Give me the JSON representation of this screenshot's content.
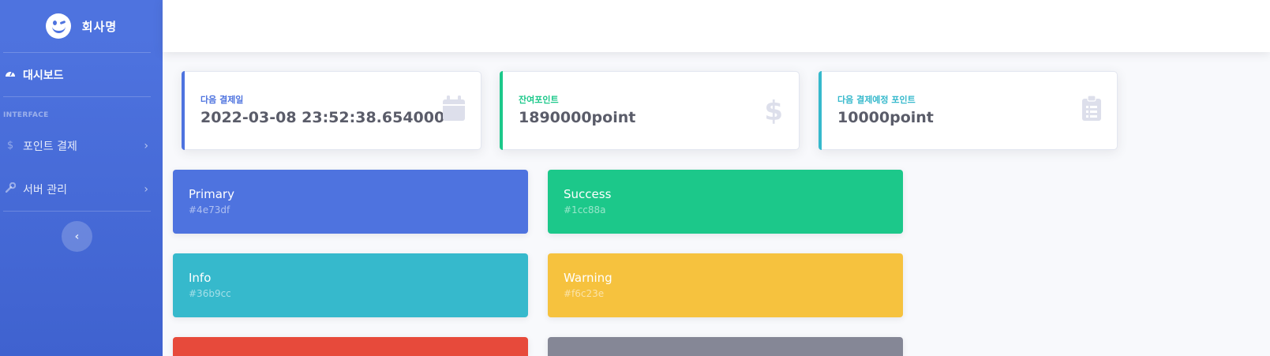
{
  "brand": {
    "name": "회사명",
    "logo_icon": "winking-face-icon"
  },
  "sidebar": {
    "dashboard": {
      "label": "대시보드",
      "icon": "tachometer-icon"
    },
    "heading": "INTERFACE",
    "items": [
      {
        "label": "포인트 결제",
        "icon": "dollar-icon"
      },
      {
        "label": "서버 관리",
        "icon": "wrench-icon"
      }
    ],
    "toggle_icon": "chevron-left-icon"
  },
  "stats": [
    {
      "label": "다음 결제일",
      "value": "2022-03-08 23:52:38.654000",
      "color": "#4e73df",
      "icon": "calendar-icon"
    },
    {
      "label": "잔여포인트",
      "value": "1890000point",
      "color": "#1cc88a",
      "icon": "dollar-icon"
    },
    {
      "label": "다음 결제예정 포인트",
      "value": "10000point",
      "color": "#36b9cc",
      "icon": "clipboard-list-icon"
    }
  ],
  "color_cards": [
    {
      "name": "Primary",
      "hex": "#4e73df"
    },
    {
      "name": "Success",
      "hex": "#1cc88a"
    },
    {
      "name": "Info",
      "hex": "#36b9cc"
    },
    {
      "name": "Warning",
      "hex": "#f6c23e"
    },
    {
      "name": "",
      "hex": "#e74a3b"
    },
    {
      "name": "",
      "hex": "#858796"
    }
  ]
}
